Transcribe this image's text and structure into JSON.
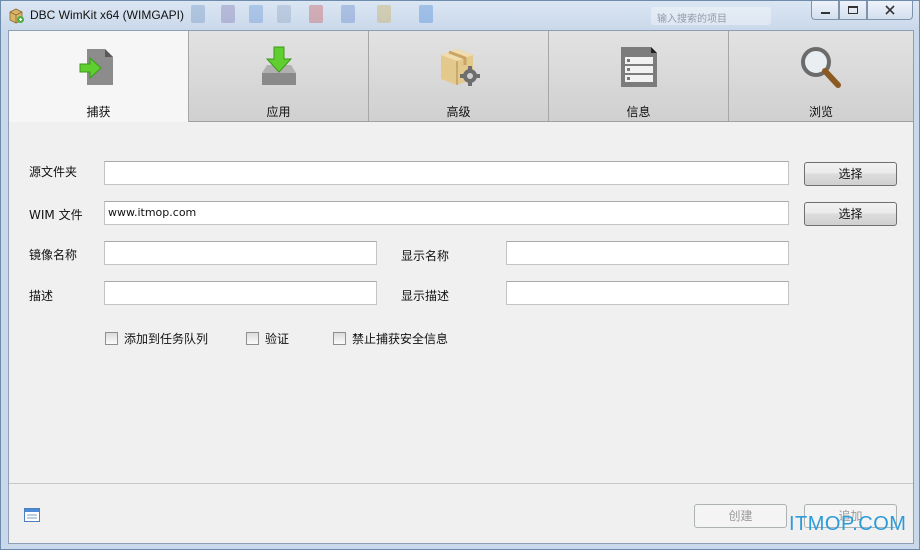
{
  "window": {
    "title": "DBC WimKit x64 (WIMGAPI)",
    "controls": {
      "minimize": "—",
      "maximize": "□",
      "close": "✕"
    },
    "ghost_search": "输入搜索的项目"
  },
  "tabs": [
    {
      "label": "捕获",
      "icon": "capture-icon",
      "active": true
    },
    {
      "label": "应用",
      "icon": "apply-download-icon",
      "active": false
    },
    {
      "label": "高级",
      "icon": "advanced-box-icon",
      "active": false
    },
    {
      "label": "信息",
      "icon": "info-document-icon",
      "active": false
    },
    {
      "label": "浏览",
      "icon": "magnifier-icon",
      "active": false
    }
  ],
  "form": {
    "source_folder": {
      "label": "源文件夹",
      "value": "",
      "button": "选择"
    },
    "wim_file": {
      "label": "WIM 文件",
      "value": "www.itmop.com",
      "button": "选择"
    },
    "image_name": {
      "label": "镜像名称",
      "value": ""
    },
    "display_name": {
      "label": "显示名称",
      "value": ""
    },
    "description": {
      "label": "描述",
      "value": ""
    },
    "display_description": {
      "label": "显示描述",
      "value": ""
    }
  },
  "options": [
    {
      "label": "添加到任务队列",
      "checked": false
    },
    {
      "label": "验证",
      "checked": false
    },
    {
      "label": "禁止捕获安全信息",
      "checked": false
    }
  ],
  "footer": {
    "create_button": "创建",
    "add_button": "追加"
  },
  "watermark": "ITMOP.COM"
}
